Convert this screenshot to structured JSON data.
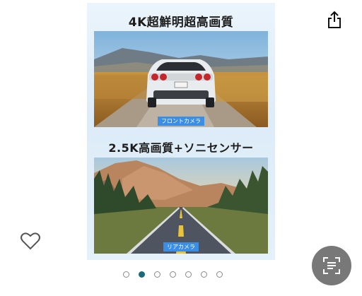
{
  "product_gallery": {
    "slide": {
      "headline_front": "4K超鮮明超高画質",
      "front_camera_label": "フロントカメラ",
      "headline_rear": "2.5K高画質+ソニセンサー",
      "rear_camera_label": "リアカメラ"
    },
    "page_count": 7,
    "active_index": 1
  },
  "icons": {
    "share": "share-icon",
    "favorite": "heart-icon",
    "visual_search": "scan-icon"
  },
  "colors": {
    "active_dot": "#1a6a7a",
    "camera_label_bg": "#3a8ee6",
    "scan_button_bg": "#787878"
  }
}
